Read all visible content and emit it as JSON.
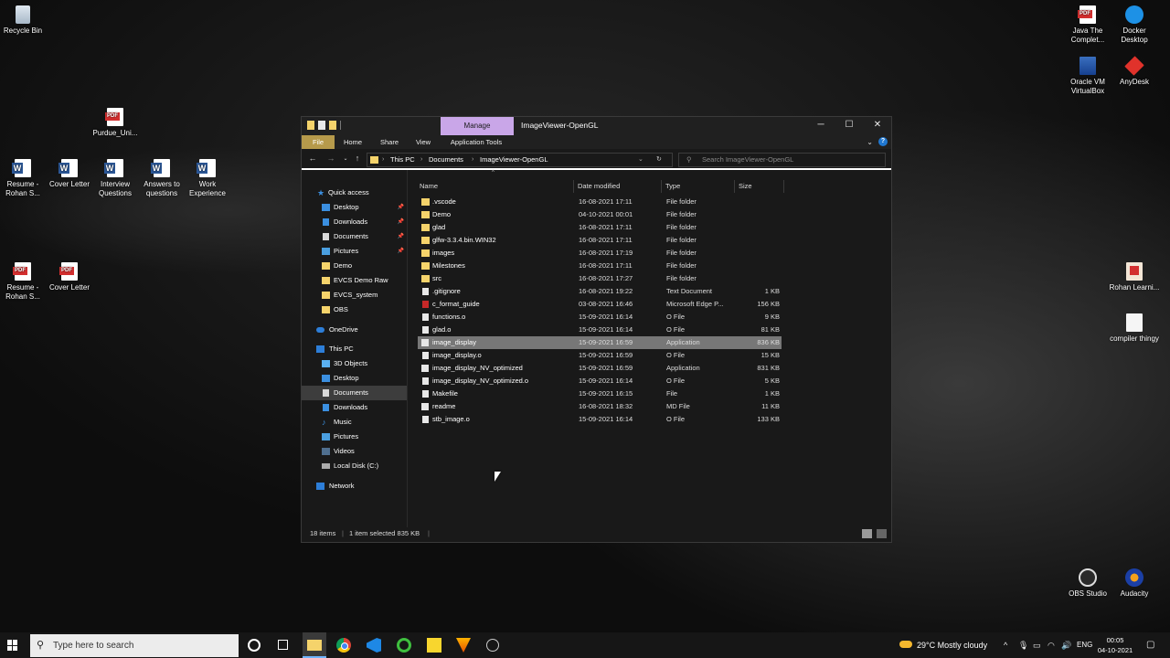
{
  "desktop": {
    "icons": [
      {
        "label": "Recycle Bin",
        "icon": "recycle-bin-icon"
      },
      {
        "label": "Purdue_Uni...",
        "icon": "pdf-icon"
      },
      {
        "label": "Resume - Rohan S...",
        "icon": "word-icon"
      },
      {
        "label": "Cover Letter",
        "icon": "word-icon"
      },
      {
        "label": "Interview Questions",
        "icon": "word-icon"
      },
      {
        "label": "Answers to questions",
        "icon": "word-icon"
      },
      {
        "label": "Work Experience",
        "icon": "word-icon"
      },
      {
        "label": "Resume - Rohan S...",
        "icon": "pdf-icon"
      },
      {
        "label": "Cover Letter",
        "icon": "pdf-icon"
      },
      {
        "label": "Java The Complet...",
        "icon": "pdf-icon"
      },
      {
        "label": "Docker Desktop",
        "icon": "docker-icon"
      },
      {
        "label": "Oracle VM VirtualBox",
        "icon": "virtualbox-icon"
      },
      {
        "label": "AnyDesk",
        "icon": "anydesk-icon"
      },
      {
        "label": "Rohan Learni...",
        "icon": "document-icon"
      },
      {
        "label": "compiler thingy",
        "icon": "text-file-icon"
      },
      {
        "label": "OBS Studio",
        "icon": "obs-icon"
      },
      {
        "label": "Audacity",
        "icon": "audacity-icon"
      }
    ]
  },
  "explorer": {
    "title": "ImageViewer-OpenGL",
    "manage_tab": "Manage",
    "controls": {
      "minimize": "─",
      "maximize": "☐",
      "close": "✕"
    },
    "ribbon_tabs": [
      "File",
      "Home",
      "Share",
      "View",
      "Application Tools"
    ],
    "breadcrumb": [
      "This PC",
      "Documents",
      "ImageViewer-OpenGL"
    ],
    "search_placeholder": "Search ImageViewer-OpenGL",
    "nav_pane": {
      "quick_access": "Quick access",
      "quick_items": [
        {
          "label": "Desktop",
          "pinned": true
        },
        {
          "label": "Downloads",
          "pinned": true
        },
        {
          "label": "Documents",
          "pinned": true
        },
        {
          "label": "Pictures",
          "pinned": true
        },
        {
          "label": "Demo",
          "pinned": false
        },
        {
          "label": "EVCS Demo Raw",
          "pinned": false
        },
        {
          "label": "EVCS_system",
          "pinned": false
        },
        {
          "label": "OBS",
          "pinned": false
        }
      ],
      "onedrive": "OneDrive",
      "this_pc": "This PC",
      "pc_items": [
        "3D Objects",
        "Desktop",
        "Documents",
        "Downloads",
        "Music",
        "Pictures",
        "Videos",
        "Local Disk (C:)"
      ],
      "network": "Network"
    },
    "columns": [
      "Name",
      "Date modified",
      "Type",
      "Size"
    ],
    "files": [
      {
        "name": ".vscode",
        "date": "16-08-2021 17:11",
        "type": "File folder",
        "size": "",
        "kind": "folder"
      },
      {
        "name": "Demo",
        "date": "04-10-2021 00:01",
        "type": "File folder",
        "size": "",
        "kind": "folder"
      },
      {
        "name": "glad",
        "date": "16-08-2021 17:11",
        "type": "File folder",
        "size": "",
        "kind": "folder"
      },
      {
        "name": "glfw-3.3.4.bin.WIN32",
        "date": "16-08-2021 17:11",
        "type": "File folder",
        "size": "",
        "kind": "folder"
      },
      {
        "name": "images",
        "date": "16-08-2021 17:19",
        "type": "File folder",
        "size": "",
        "kind": "folder"
      },
      {
        "name": "Milestones",
        "date": "16-08-2021 17:11",
        "type": "File folder",
        "size": "",
        "kind": "folder"
      },
      {
        "name": "src",
        "date": "16-08-2021 17:27",
        "type": "File folder",
        "size": "",
        "kind": "folder"
      },
      {
        "name": ".gitignore",
        "date": "16-08-2021 19:22",
        "type": "Text Document",
        "size": "1 KB",
        "kind": "file"
      },
      {
        "name": "c_format_guide",
        "date": "03-08-2021 16:46",
        "type": "Microsoft Edge P...",
        "size": "156 KB",
        "kind": "edge"
      },
      {
        "name": "functions.o",
        "date": "15-09-2021 16:14",
        "type": "O File",
        "size": "9 KB",
        "kind": "file"
      },
      {
        "name": "glad.o",
        "date": "15-09-2021 16:14",
        "type": "O File",
        "size": "81 KB",
        "kind": "file"
      },
      {
        "name": "image_display",
        "date": "15-09-2021 16:59",
        "type": "Application",
        "size": "836 KB",
        "kind": "app",
        "selected": true
      },
      {
        "name": "image_display.o",
        "date": "15-09-2021 16:59",
        "type": "O File",
        "size": "15 KB",
        "kind": "file"
      },
      {
        "name": "image_display_NV_optimized",
        "date": "15-09-2021 16:59",
        "type": "Application",
        "size": "831 KB",
        "kind": "app"
      },
      {
        "name": "image_display_NV_optimized.o",
        "date": "15-09-2021 16:14",
        "type": "O File",
        "size": "5 KB",
        "kind": "file"
      },
      {
        "name": "Makefile",
        "date": "15-09-2021 16:15",
        "type": "File",
        "size": "1 KB",
        "kind": "file"
      },
      {
        "name": "readme",
        "date": "16-08-2021 18:32",
        "type": "MD File",
        "size": "11 KB",
        "kind": "app"
      },
      {
        "name": "stb_image.o",
        "date": "15-09-2021 16:14",
        "type": "O File",
        "size": "133 KB",
        "kind": "file"
      }
    ],
    "status": {
      "items": "18 items",
      "selected": "1 item selected  835 KB"
    }
  },
  "taskbar": {
    "search_placeholder": "Type here to search",
    "weather": "29°C  Mostly cloudy",
    "language": "ENG",
    "time": "00:05",
    "date": "04-10-2021"
  }
}
